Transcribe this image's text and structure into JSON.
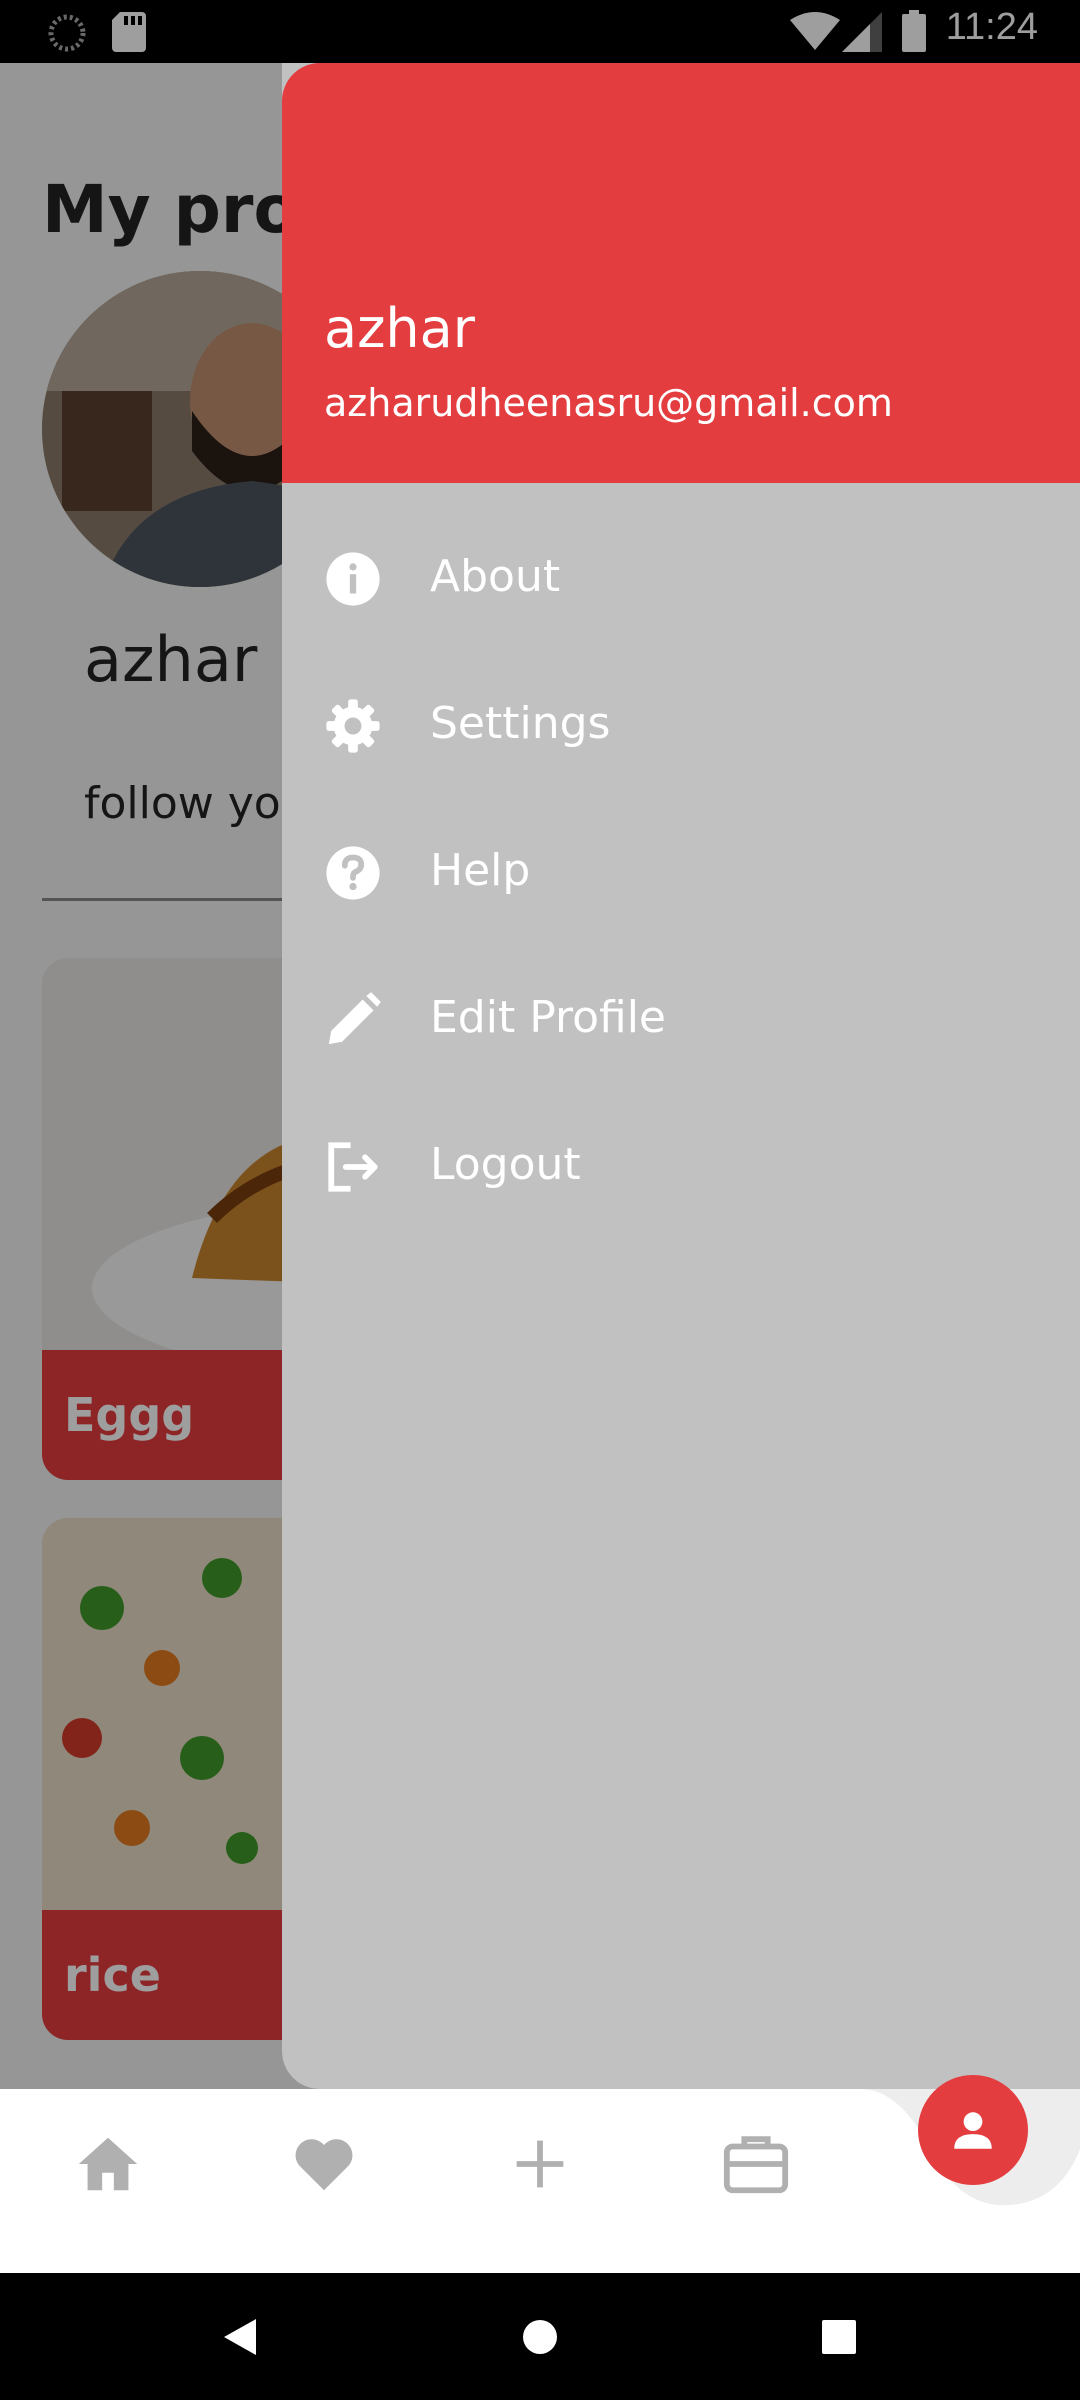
{
  "status_bar": {
    "time": "11:24"
  },
  "profile": {
    "title": "My prof",
    "name": "azhar",
    "bio": "follow yo"
  },
  "cards": [
    {
      "title": "Eggg"
    },
    {
      "title": "rice"
    }
  ],
  "drawer": {
    "user_name": "azhar",
    "user_email": "azharudheenasru@gmail.com",
    "items": [
      {
        "label": "About",
        "icon": "info-icon"
      },
      {
        "label": "Settings",
        "icon": "gear-icon"
      },
      {
        "label": "Help",
        "icon": "help-icon"
      },
      {
        "label": "Edit Profile",
        "icon": "pencil-icon"
      },
      {
        "label": "Logout",
        "icon": "logout-icon"
      }
    ]
  },
  "bottom_nav": {
    "items": [
      "home-icon",
      "heart-icon",
      "plus-icon",
      "briefcase-icon",
      "person-icon"
    ],
    "active": "person-icon"
  },
  "colors": {
    "accent": "#e43d40",
    "drawer_bg": "#c1c1c1",
    "nav_icon": "#b0b0b0"
  }
}
